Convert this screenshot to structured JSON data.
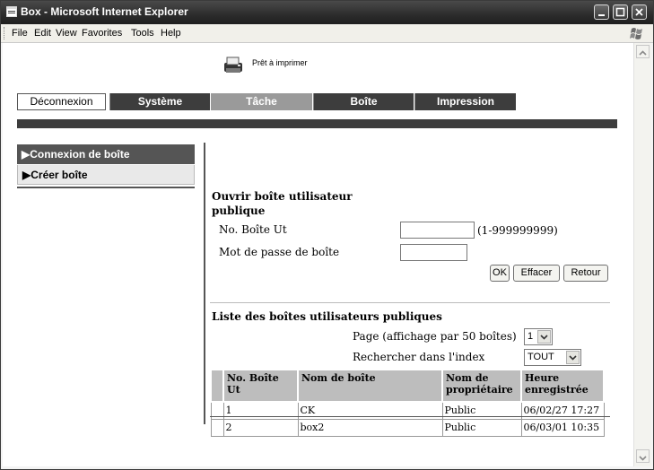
{
  "window": {
    "title": "Box - Microsoft Internet Explorer"
  },
  "menu": [
    "File",
    "Edit",
    "View",
    "Favorites",
    "Tools",
    "Help"
  ],
  "status": {
    "printer": "Prêt à imprimer"
  },
  "tabs": {
    "disconnect": "Déconnexion",
    "system": "Système",
    "task": "Tâche",
    "box": "Boîte",
    "print": "Impression"
  },
  "sidebar": {
    "items": [
      {
        "label": "▶Connexion de boîte"
      },
      {
        "label": "▶Créer boîte"
      }
    ]
  },
  "open_box": {
    "heading": "Ouvrir boîte utilisateur publique",
    "box_no_label": "No. Boîte Ut",
    "box_no_value": "",
    "box_no_range": "(1-999999999)",
    "password_label": "Mot de passe de boîte",
    "password_value": "",
    "ok_label": "OK",
    "clear_label": "Effacer",
    "back_label": "Retour"
  },
  "public_boxes": {
    "heading": "Liste des boîtes utilisateurs publiques",
    "page_label": "Page (affichage par 50 boîtes)",
    "page_value": "1",
    "index_label": "Rechercher dans l'index",
    "index_value": "TOUT",
    "columns": [
      "No. Boîte Ut",
      "Nom de boîte",
      "Nom de propriétaire",
      "Heure enregistrée"
    ],
    "rows": [
      {
        "no": "1",
        "name": "CK",
        "owner": "Public",
        "time": "06/02/27 17:27"
      },
      {
        "no": "2",
        "name": "box2",
        "owner": "Public",
        "time": "06/03/01 10:35"
      }
    ]
  }
}
